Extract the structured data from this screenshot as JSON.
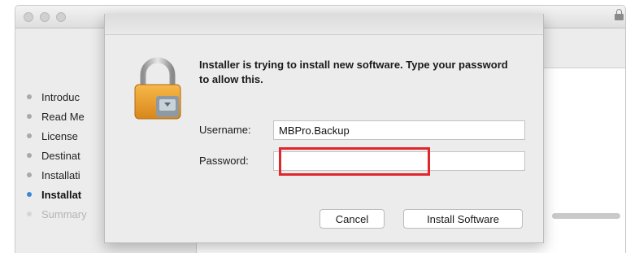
{
  "background_window": {
    "steps": [
      {
        "label": "Introduc",
        "state": "done"
      },
      {
        "label": "Read Me",
        "state": "done"
      },
      {
        "label": "License",
        "state": "done"
      },
      {
        "label": "Destinat",
        "state": "done"
      },
      {
        "label": "Installati",
        "state": "done"
      },
      {
        "label": "Installat",
        "state": "active"
      },
      {
        "label": "Summary",
        "state": "pending"
      }
    ],
    "icons": [
      "window-close-icon",
      "window-minimize-icon",
      "window-zoom-icon",
      "lock-icon"
    ]
  },
  "dialog": {
    "message": "Installer is trying to install new software. Type your password to allow this.",
    "icon": "padlock-icon",
    "username": {
      "label": "Username:",
      "value": "MBPro.Backup"
    },
    "password": {
      "label": "Password:",
      "value": ""
    },
    "buttons": {
      "cancel": "Cancel",
      "install": "Install Software"
    },
    "highlight_color": "#e1262c"
  }
}
